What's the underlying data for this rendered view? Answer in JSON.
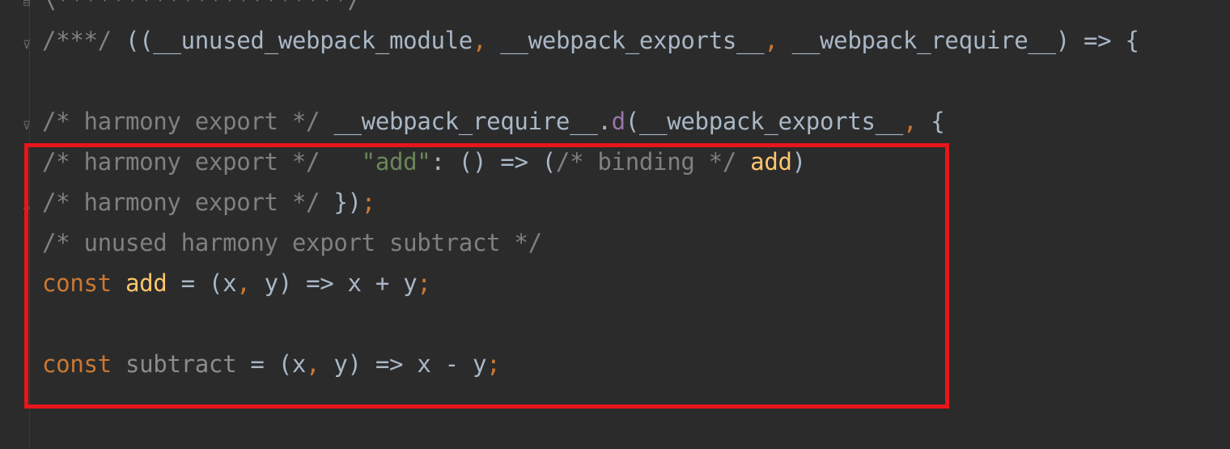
{
  "editor": {
    "lines": [
      {
        "tokens": [
          {
            "cls": "c",
            "text": "\\*********************/"
          }
        ]
      },
      {
        "tokens": [
          {
            "cls": "c",
            "text": "/***/ "
          },
          {
            "cls": "pl",
            "text": "((__unused_webpack_module"
          },
          {
            "cls": "kw",
            "text": ","
          },
          {
            "cls": "pl",
            "text": " __webpack_exports__"
          },
          {
            "cls": "kw",
            "text": ","
          },
          {
            "cls": "pl",
            "text": " __webpack_require__) => {"
          }
        ]
      },
      {
        "tokens": [
          {
            "cls": "pl",
            "text": " "
          }
        ]
      },
      {
        "tokens": [
          {
            "cls": "c",
            "text": "/* harmony export */ "
          },
          {
            "cls": "pl",
            "text": "__webpack_require__."
          },
          {
            "cls": "pu",
            "text": "d"
          },
          {
            "cls": "pl",
            "text": "(__webpack_exports__"
          },
          {
            "cls": "kw",
            "text": ","
          },
          {
            "cls": "pl",
            "text": " {"
          }
        ]
      },
      {
        "tokens": [
          {
            "cls": "c",
            "text": "/* harmony export */   "
          },
          {
            "cls": "str",
            "text": "\"add\""
          },
          {
            "cls": "pl",
            "text": ": () => ("
          },
          {
            "cls": "c",
            "text": "/* binding */ "
          },
          {
            "cls": "fn",
            "text": "add"
          },
          {
            "cls": "pl",
            "text": ")"
          }
        ]
      },
      {
        "tokens": [
          {
            "cls": "c",
            "text": "/* harmony export */ "
          },
          {
            "cls": "pl",
            "text": "})"
          },
          {
            "cls": "kw",
            "text": ";"
          }
        ]
      },
      {
        "tokens": [
          {
            "cls": "c",
            "text": "/* unused harmony export subtract */"
          }
        ]
      },
      {
        "tokens": [
          {
            "cls": "kw",
            "text": "const "
          },
          {
            "cls": "fn",
            "text": "add"
          },
          {
            "cls": "pl",
            "text": " = (x"
          },
          {
            "cls": "kw",
            "text": ","
          },
          {
            "cls": "pl",
            "text": " y) => x + y"
          },
          {
            "cls": "kw",
            "text": ";"
          }
        ]
      },
      {
        "tokens": [
          {
            "cls": "pl",
            "text": " "
          }
        ]
      },
      {
        "tokens": [
          {
            "cls": "kw",
            "text": "const "
          },
          {
            "cls": "gray",
            "text": "subtract"
          },
          {
            "cls": "pl",
            "text": " = (x"
          },
          {
            "cls": "kw",
            "text": ","
          },
          {
            "cls": "pl",
            "text": " y) => x - y"
          },
          {
            "cls": "kw",
            "text": ";"
          }
        ]
      }
    ]
  },
  "colors": {
    "background": "#2b2b2b",
    "comment": "#808080",
    "keyword": "#cc7832",
    "plain": "#a9b7c6",
    "function": "#ffc66d",
    "string": "#6a8759",
    "property": "#9876aa",
    "highlight_box": "#e8151a"
  },
  "gutter_icons": [
    "fold-icon",
    "fold-icon",
    "fold-icon",
    "fold-end-icon"
  ]
}
